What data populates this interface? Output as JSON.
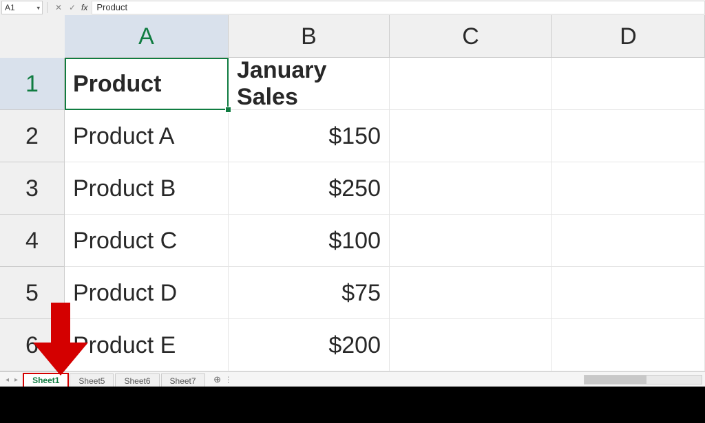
{
  "formula_bar": {
    "name_box": "A1",
    "cancel_icon": "✕",
    "enter_icon": "✓",
    "fx_label": "fx",
    "formula": "Product"
  },
  "columns": [
    "A",
    "B",
    "C",
    "D"
  ],
  "rows": [
    "1",
    "2",
    "3",
    "4",
    "5",
    "6"
  ],
  "cells": {
    "A1": "Product",
    "B1": "January Sales",
    "A2": "Product A",
    "B2": "$150",
    "A3": "Product B",
    "B3": "$250",
    "A4": "Product C",
    "B4": "$100",
    "A5": "Product D",
    "B5": "$75",
    "A6": "Product E",
    "B6": "$200"
  },
  "selected_cell": "A1",
  "tabs": {
    "items": [
      "Sheet1",
      "Sheet5",
      "Sheet6",
      "Sheet7"
    ],
    "active": "Sheet1",
    "add_icon": "⊕"
  },
  "annotation": {
    "color": "#d40000"
  }
}
